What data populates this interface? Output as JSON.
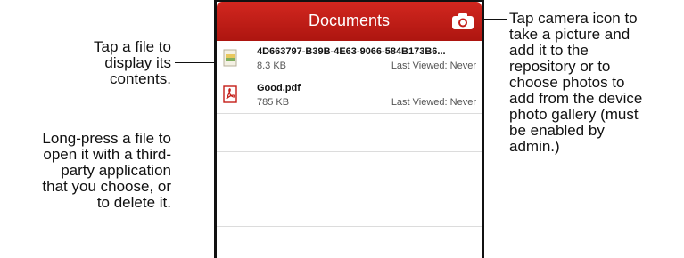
{
  "callouts": {
    "tap_file": "Tap a file to\ndisplay its\ncontents.",
    "long_press": "Long-press a file to\nopen it with a third-\nparty application\nthat you choose, or\nto delete it.",
    "camera": "Tap camera icon to\ntake a picture and\nadd it to the\nrepository or to\nchoose photos to\nadd from the device\nphoto gallery (must\nbe enabled by\nadmin.)"
  },
  "header": {
    "title": "Documents",
    "camera_icon": "camera-icon",
    "color": "#c41d17"
  },
  "files": [
    {
      "name": "4D663797-B39B-4E63-9066-584B173B6...",
      "size": "8.3 KB",
      "last_viewed": "Last Viewed: Never",
      "icon": "image-file-icon"
    },
    {
      "name": "Good.pdf",
      "size": "785 KB",
      "last_viewed": "Last Viewed: Never",
      "icon": "pdf-file-icon"
    }
  ]
}
